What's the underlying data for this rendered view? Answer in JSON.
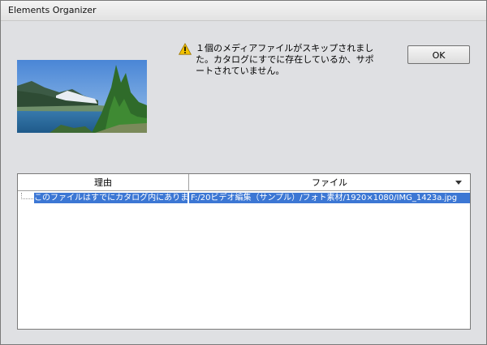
{
  "window": {
    "title": "Elements Organizer"
  },
  "dialog": {
    "message": "１個のメディアファイルがスキップされました。カタログにすでに存在しているか、サポートされていません。",
    "ok_label": "OK"
  },
  "icons": {
    "warning": "warning-icon",
    "sort": "chevron-down-icon"
  },
  "table": {
    "headers": {
      "reason": "理由",
      "file": "ファイル"
    },
    "rows": [
      {
        "reason": "このファイルはすでにカタログ内にあります",
        "file": "F:/20ビデオ編集（サンプル）/フォト素材/1920×1080/IMG_1423a.jpg"
      }
    ]
  },
  "colors": {
    "dialog_bg": "#dfe0e3",
    "selection": "#3c77d4",
    "warning": "#f2c200"
  }
}
